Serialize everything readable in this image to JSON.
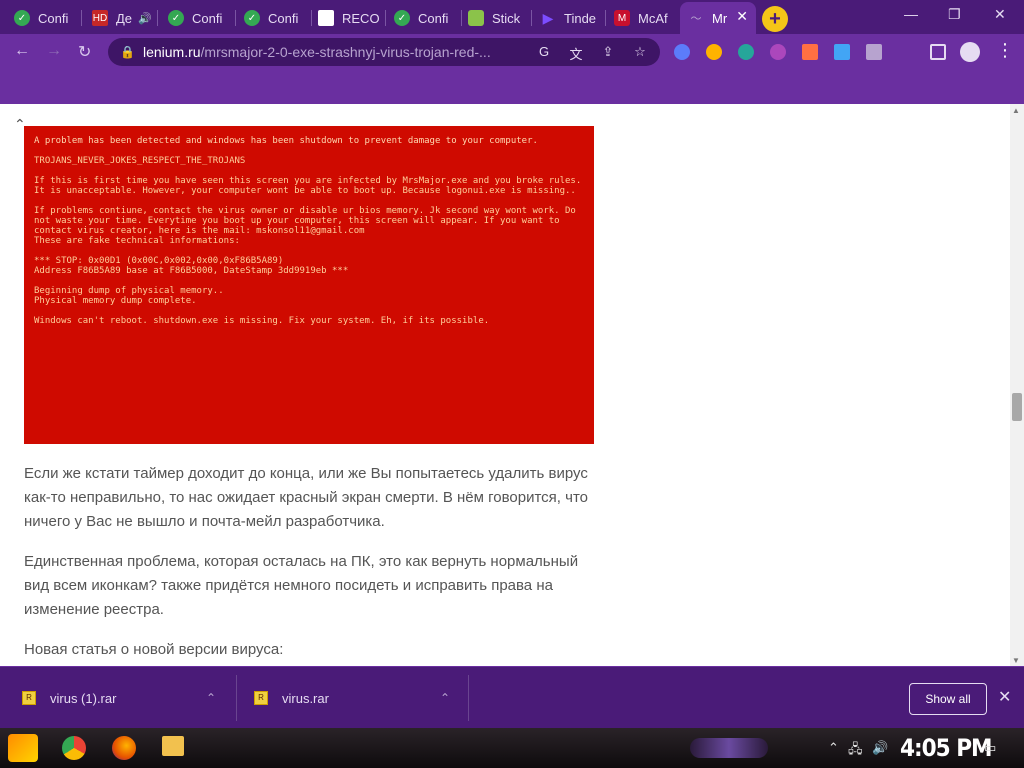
{
  "browser": {
    "tabs": [
      {
        "label": "Confi",
        "favicon": "check-circle-icon",
        "color": "#34a853"
      },
      {
        "label": "Де",
        "favicon": "hd-icon",
        "color": "#c62828",
        "audio": true
      },
      {
        "label": "Confi",
        "favicon": "check-circle-icon",
        "color": "#34a853"
      },
      {
        "label": "Confi",
        "favicon": "check-circle-icon",
        "color": "#34a853"
      },
      {
        "label": "RECO",
        "favicon": "document-icon",
        "color": "#ffffff"
      },
      {
        "label": "Confi",
        "favicon": "check-circle-icon",
        "color": "#34a853"
      },
      {
        "label": "Stick",
        "favicon": "sticker-icon",
        "color": "#8bc34a"
      },
      {
        "label": "Tinde",
        "favicon": "play-icon",
        "color": "#7c4dff"
      },
      {
        "label": "McAf",
        "favicon": "mcafee-shield-icon",
        "color": "#c8102e"
      },
      {
        "label": "Mr",
        "favicon": "site-icon",
        "color": "#6a2fa0",
        "active": true
      }
    ],
    "address_host": "lenium.ru",
    "address_path": "/mrsmajor-2-0-exe-strashnyj-virus-trojan-red-...",
    "theme_color": "#6a2fa0"
  },
  "bsod": {
    "lines": [
      "A problem has been detected and windows has been shutdown to prevent damage to your computer.",
      "TROJANS_NEVER_JOKES_RESPECT_THE_TROJANS",
      "If this is first time you have seen this screen you are infected by MrsMajor.exe and you broke rules. It is unacceptable. However, your computer wont be able to boot up. Because logonui.exe is missing..",
      "If problems contiune, contact the virus owner or disable ur bios memory. Jk second way wont work. Do not waste your time. Everytime you boot up your computer, this screen will appear. If you want to contact virus creator, here is the mail: mskonsol11@gmail.com\nThese are fake technical informations:",
      "*** STOP: 0x00D1 (0x00C,0x002,0x00,0xF86B5A89)\nAddress F86B5A89 base at F86B5000, DateStamp 3dd9919eb ***",
      "Beginning dump of physical memory..\nPhysical memory dump complete.",
      "Windows can't reboot. shutdown.exe is missing. Fix your system. Eh, if its possible."
    ],
    "bg_color": "#cf0a00"
  },
  "article": {
    "paragraphs": [
      "Если же кстати таймер доходит до конца, или же Вы попытаетесь удалить вирус как-то неправильно, то нас ожидает красный экран смерти. В нём говорится, что ничего у Вас не вышло и почта-мейл разработчика.",
      "Единственная проблема, которая осталась на ПК, это как вернуть нормальный вид всем иконкам? также придётся немного посидеть и исправить права на изменение реестра.",
      "Новая статья о новой версии вируса:"
    ]
  },
  "downloads": {
    "items": [
      {
        "name": "virus (1).rar"
      },
      {
        "name": "virus.rar"
      }
    ],
    "show_all_label": "Show all"
  },
  "taskbar": {
    "clock": "4:05 PM"
  }
}
